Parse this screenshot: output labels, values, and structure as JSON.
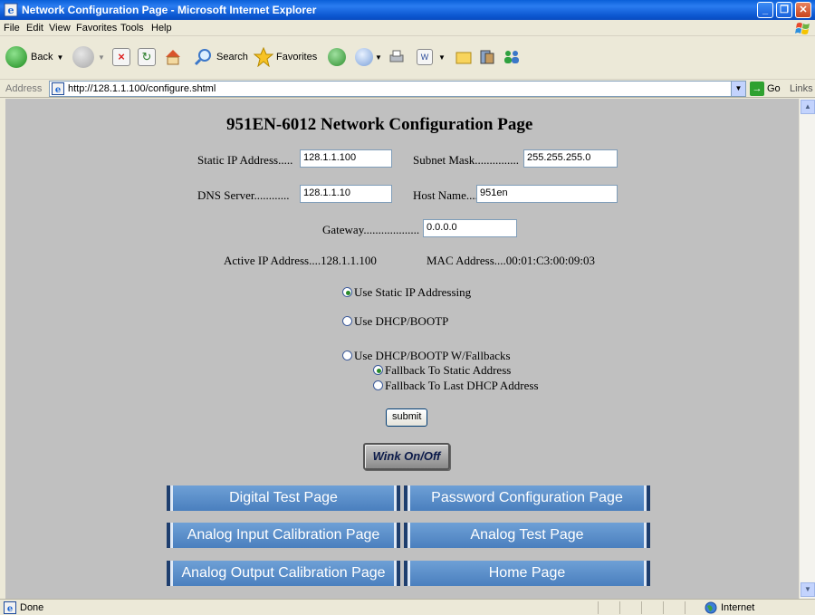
{
  "window": {
    "title": "Network Configuration Page - Microsoft Internet Explorer"
  },
  "menu": [
    "File",
    "Edit",
    "View",
    "Favorites",
    "Tools",
    "Help"
  ],
  "toolbar": {
    "back_label": "Back",
    "search_label": "Search",
    "favorites_label": "Favorites"
  },
  "address": {
    "label": "Address",
    "url": "http://128.1.1.100/configure.shtml",
    "go_label": "Go",
    "links_label": "Links"
  },
  "page": {
    "heading": "951EN-6012 Network Configuration Page",
    "static_ip_label": "Static IP Address.....",
    "static_ip_value": "128.1.1.100",
    "subnet_label": "Subnet Mask...............",
    "subnet_value": "255.255.255.0",
    "dns_label": "DNS Server............",
    "dns_value": "128.1.1.10",
    "hostname_label": "Host Name...........",
    "hostname_value": "951en",
    "gateway_label": "Gateway...................",
    "gateway_value": "0.0.0.0",
    "active_ip_text": "Active IP Address....128.1.1.100",
    "mac_text": "MAC Address....00:01:C3:00:09:03",
    "radio_static": "Use Static IP Addressing",
    "radio_dhcp": "Use DHCP/BOOTP",
    "radio_dhcp_fallback": "Use DHCP/BOOTP W/Fallbacks",
    "radio_fallback_static": "Fallback To Static Address",
    "radio_fallback_last": "Fallback To Last DHCP Address",
    "submit_label": "submit",
    "wink_label": "Wink On/Off",
    "nav": {
      "digital_test": "Digital Test Page",
      "password_config": "Password Configuration Page",
      "analog_input_cal": "Analog Input Calibration Page",
      "analog_test": "Analog Test Page",
      "analog_output_cal": "Analog Output Calibration Page",
      "home": "Home Page"
    }
  },
  "status": {
    "left": "Done",
    "zone": "Internet"
  },
  "colors": {
    "titlebar": "#0a5fd8",
    "content_bg": "#c0c0c0",
    "nav_button": "#5b8fcb"
  }
}
